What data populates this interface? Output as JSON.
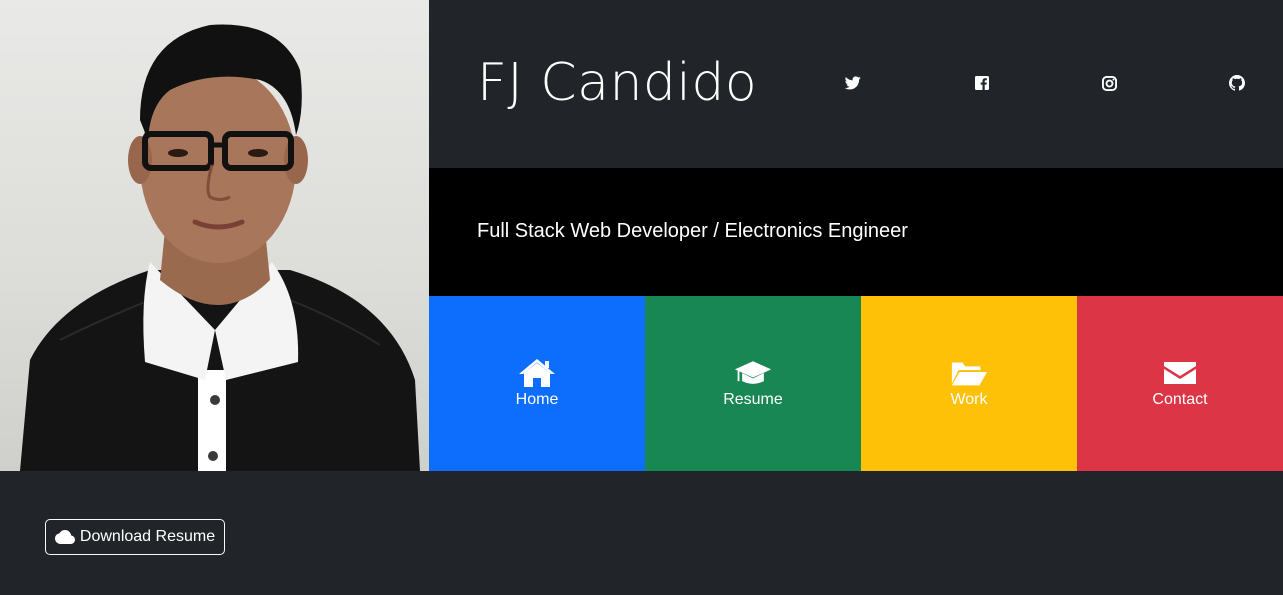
{
  "profile": {
    "name": "FJ Candido",
    "tagline": "Full Stack Web Developer / Electronics Engineer"
  },
  "social": [
    {
      "icon": "twitter-icon"
    },
    {
      "icon": "facebook-icon"
    },
    {
      "icon": "instagram-icon"
    },
    {
      "icon": "github-icon"
    }
  ],
  "nav": [
    {
      "label": "Home",
      "icon": "home-icon",
      "color": "#0d6efd"
    },
    {
      "label": "Resume",
      "icon": "graduation-cap-icon",
      "color": "#198754"
    },
    {
      "label": "Work",
      "icon": "folder-open-icon",
      "color": "#ffc107"
    },
    {
      "label": "Contact",
      "icon": "envelope-icon",
      "color": "#dc3545"
    }
  ],
  "actions": {
    "download_label": "Download Resume",
    "download_icon": "cloud-icon"
  },
  "colors": {
    "page_bg": "#212529",
    "band_bg": "#000000"
  }
}
